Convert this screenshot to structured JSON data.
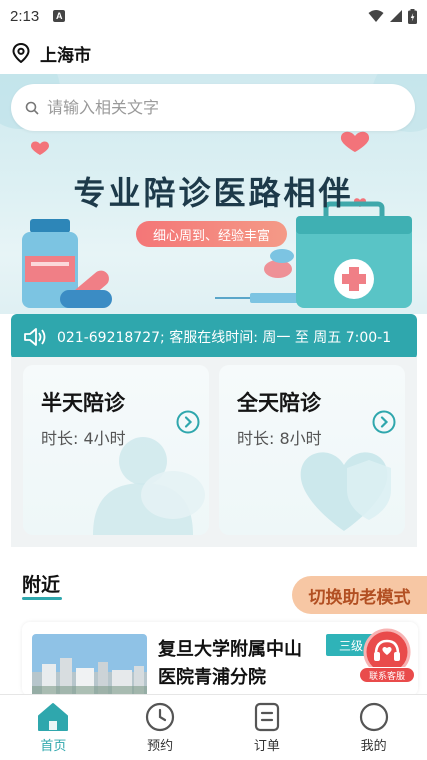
{
  "status_bar": {
    "time": "2:13",
    "notification_badge": "A"
  },
  "location": {
    "city": "上海市",
    "icon": "location-pin-icon"
  },
  "search": {
    "placeholder": "请输入相关文字",
    "icon": "search-icon"
  },
  "banner": {
    "title": "专业陪诊医路相伴",
    "subtitle": "细心周到、经验丰富"
  },
  "notice": {
    "icon": "speaker-icon",
    "text": "021-69218727;  客服在线时间: 周一 至 周五 7:00-1"
  },
  "services": [
    {
      "title": "半天陪诊",
      "duration": "时长:  4小时",
      "action_icon": "chevron-right-circle-icon"
    },
    {
      "title": "全天陪诊",
      "duration": "时长:  8小时",
      "action_icon": "chevron-right-circle-icon"
    }
  ],
  "nearby": {
    "title": "附近",
    "elderly_mode_label": "切换助老模式",
    "hospital": {
      "name": "复旦大学附属中山医院青浦分院",
      "level": "三级"
    }
  },
  "customer_service": {
    "label": "联系客服",
    "icon": "headset-icon"
  },
  "tabs": [
    {
      "label": "首页",
      "icon": "home-icon",
      "active": true
    },
    {
      "label": "预约",
      "icon": "clock-icon",
      "active": false
    },
    {
      "label": "订单",
      "icon": "order-icon",
      "active": false
    },
    {
      "label": "我的",
      "icon": "profile-icon",
      "active": false
    }
  ],
  "colors": {
    "accent": "#2fa7ad",
    "notice_bg": "#2fa7ad",
    "elderly_bg": "#f7c7a4",
    "badge_red": "#e94b4b"
  }
}
